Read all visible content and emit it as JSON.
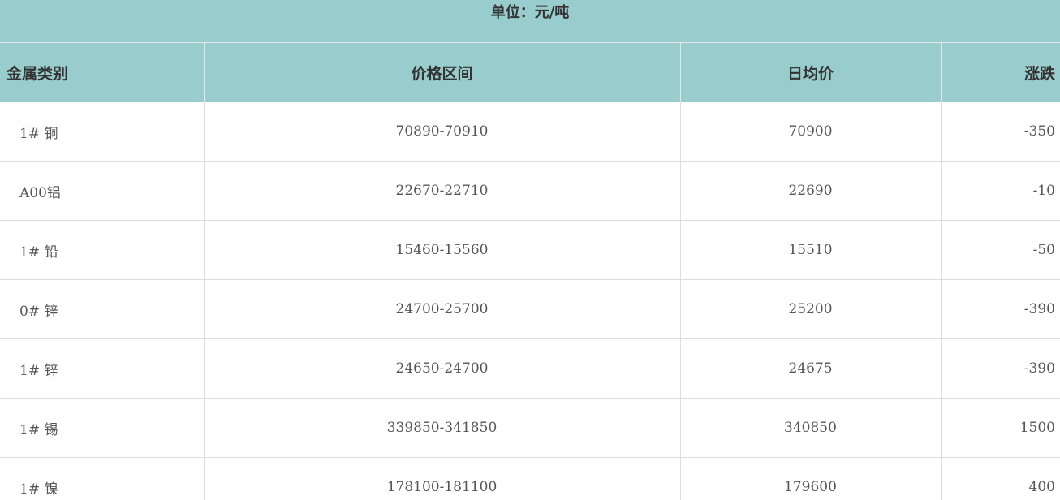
{
  "unit_label": "单位：元/吨",
  "table": {
    "headers": [
      "金属类别",
      "价格区间",
      "日均价",
      "涨跌"
    ],
    "rows": [
      {
        "metal": "1# 铜",
        "range": "70890-70910",
        "avg": "70900",
        "change": "-350"
      },
      {
        "metal": "A00铝",
        "range": "22670-22710",
        "avg": "22690",
        "change": "-10"
      },
      {
        "metal": "1# 铅",
        "range": "15460-15560",
        "avg": "15510",
        "change": "-50"
      },
      {
        "metal": "0# 锌",
        "range": "24700-25700",
        "avg": "25200",
        "change": "-390"
      },
      {
        "metal": "1# 锌",
        "range": "24650-24700",
        "avg": "24675",
        "change": "-390"
      },
      {
        "metal": "1# 锡",
        "range": "339850-341850",
        "avg": "340850",
        "change": "1500"
      },
      {
        "metal": "1# 镍",
        "range": "178100-181100",
        "avg": "179600",
        "change": "400"
      }
    ]
  }
}
